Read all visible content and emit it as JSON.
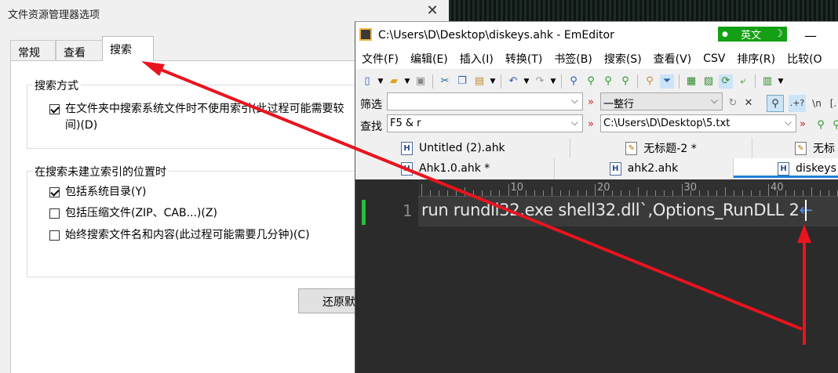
{
  "dialog": {
    "title": "文件资源管理器选项",
    "close_glyph": "✕",
    "tabs": [
      "常规",
      "查看",
      "搜索"
    ],
    "group_how": {
      "title": "搜索方式",
      "opt1_line1": "在文件夹中搜索系统文件时不使用索引(此过程可能需要较",
      "opt1_line2": "间)(D)"
    },
    "group_nonindexed": {
      "title": "在搜索未建立索引的位置时",
      "opt_system": "包括系统目录(Y)",
      "opt_zip": "包括压缩文件(ZIP、CAB...)(Z)",
      "opt_contents": "始终搜索文件名和内容(此过程可能需要几分钟)(C)"
    },
    "restore_button": "还原默"
  },
  "editor": {
    "title": "C:\\Users\\D\\Desktop\\diskeys.ahk - EmEditor",
    "ime": {
      "lang": "英文",
      "moon": "☽",
      "dot": "●"
    },
    "minimize_glyph": "—",
    "menu": [
      "文件(F)",
      "编辑(E)",
      "插入(I)",
      "转换(T)",
      "书签(B)",
      "搜索(S)",
      "查看(V)",
      "CSV",
      "排序(R)",
      "比较(O"
    ],
    "filter_bar": {
      "label": "筛选",
      "value": "",
      "mode": "一整行",
      "regex_hint": ".+?",
      "escape_hint": "\\n",
      "bracket_hint": "[."
    },
    "find_bar": {
      "label": "查找",
      "value": "F5 & r",
      "path": "C:\\Users\\D\\Desktop\\5.txt"
    },
    "tabs_row1": [
      "Untitled (2).ahk",
      "无标题-2 *",
      "无标"
    ],
    "tabs_row2": [
      "Ahk1.0.ahk *",
      "ahk2.ahk",
      "diskeys"
    ],
    "ruler_numbers": [
      "10",
      "20",
      "30",
      "40"
    ],
    "line_number": "1",
    "code_line": "run rundll32.exe shell32.dll`,Options_RunDLL 2",
    "eol_glyph": "←"
  },
  "colors": {
    "annotation_arrow": "#e8141e",
    "ime_green": "#14a014",
    "editor_bg": "#2b2b2b",
    "modified_line_marker": "#22c03a"
  }
}
